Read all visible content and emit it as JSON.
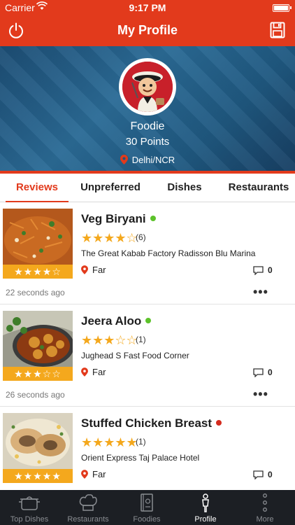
{
  "status_bar": {
    "carrier": "Carrier",
    "time": "9:17 PM"
  },
  "nav": {
    "title": "My Profile",
    "left_icon": "power-icon",
    "right_icon": "save-icon"
  },
  "profile": {
    "name": "Foodie",
    "points": "30 Points",
    "location": "Delhi/NCR"
  },
  "colors": {
    "accent": "#e23a1c",
    "star": "#f4a81d",
    "veg": "#5cc22a",
    "nonveg": "#d42b1e",
    "tabbar": "#1c1f24"
  },
  "tabs": [
    {
      "label": "Reviews",
      "active": true
    },
    {
      "label": "Unpreferred",
      "active": false
    },
    {
      "label": "Dishes",
      "active": false
    },
    {
      "label": "Restaurants",
      "active": false
    }
  ],
  "reviews": [
    {
      "dish": "Veg Biryani",
      "diet": "veg",
      "avg_rating": 4.5,
      "avg_stars": "★★★★☆",
      "user_rating": 4,
      "stars": "★★★★☆",
      "count": "(6)",
      "restaurant": "The Great Kabab Factory Radisson Blu Marina",
      "distance": "Far",
      "comments": "0",
      "time_ago": "22 seconds ago"
    },
    {
      "dish": "Jeera Aloo",
      "diet": "veg",
      "avg_rating": 3.5,
      "avg_stars": "★★★☆☆",
      "user_rating": 3.5,
      "stars": "★★★☆☆",
      "count": "(1)",
      "restaurant": "Jughead S Fast Food Corner",
      "distance": "Far",
      "comments": "0",
      "time_ago": "26 seconds ago"
    },
    {
      "dish": "Stuffed Chicken Breast",
      "diet": "nonveg",
      "avg_rating": 5,
      "avg_stars": "★★★★★",
      "user_rating": 5,
      "stars": "★★★★★",
      "count": "(1)",
      "restaurant": "Orient Express Taj Palace Hotel",
      "distance": "Far",
      "comments": "0",
      "time_ago": ""
    }
  ],
  "tabbar": [
    {
      "label": "Top Dishes",
      "icon": "cooking-pot-icon",
      "active": false
    },
    {
      "label": "Restaurants",
      "icon": "chef-hat-icon",
      "active": false
    },
    {
      "label": "Foodies",
      "icon": "menu-book-icon",
      "active": false
    },
    {
      "label": "Profile",
      "icon": "person-icon",
      "active": true
    },
    {
      "label": "More",
      "icon": "more-vertical-icon",
      "active": false
    }
  ]
}
